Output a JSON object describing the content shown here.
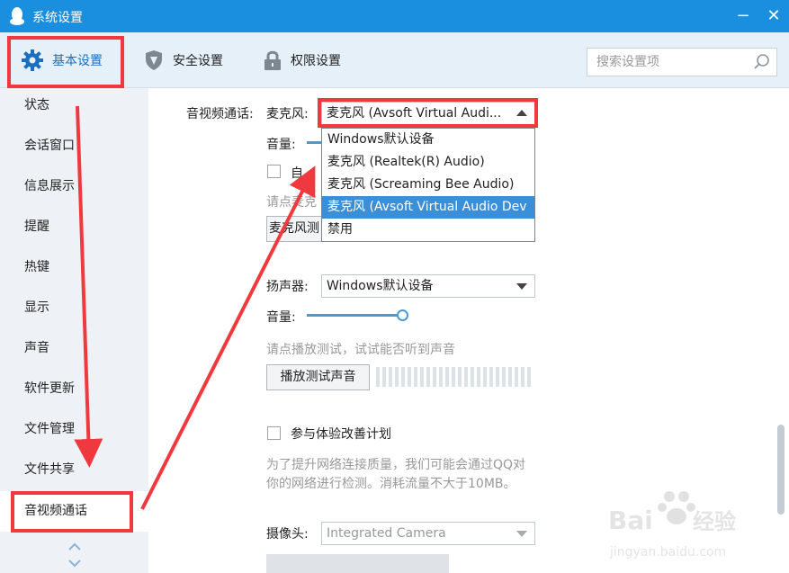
{
  "window": {
    "title": "系统设置",
    "minimize_glyph": "−",
    "close_glyph": "✕"
  },
  "tabs": [
    {
      "label": "基本设置",
      "icon": "gear-icon",
      "active": true
    },
    {
      "label": "安全设置",
      "icon": "shield-icon",
      "active": false
    },
    {
      "label": "权限设置",
      "icon": "lock-icon",
      "active": false
    }
  ],
  "search": {
    "placeholder": "搜索设置项"
  },
  "sidebar": {
    "items": [
      {
        "label": "状态"
      },
      {
        "label": "会话窗口"
      },
      {
        "label": "信息展示"
      },
      {
        "label": "提醒"
      },
      {
        "label": "热键"
      },
      {
        "label": "显示"
      },
      {
        "label": "声音"
      },
      {
        "label": "软件更新"
      },
      {
        "label": "文件管理"
      },
      {
        "label": "文件共享"
      },
      {
        "label": "音视频通话",
        "active": true
      }
    ]
  },
  "av": {
    "section_label": "音视频通话:",
    "mic_label": "麦克风:",
    "mic_selected": "麦克风 (Avsoft Virtual Audi...",
    "mic_volume_label": "音量:",
    "auto_adjust_label": "自",
    "mic_hint": "请点麦克",
    "mic_test_button": "麦克风测",
    "mic_options": [
      "Windows默认设备",
      "麦克风 (Realtek(R) Audio)",
      "麦克风 (Screaming Bee Audio)",
      "麦克风 (Avsoft Virtual Audio Dev",
      "禁用"
    ],
    "mic_highlighted_index": 3,
    "speaker_label": "扬声器:",
    "speaker_selected": "Windows默认设备",
    "speaker_volume_label": "音量:",
    "speaker_volume": 1.0,
    "speaker_hint": "请点播放测试，试试能否听到声音",
    "play_test_button": "播放测试声音",
    "ux_checkbox_label": "参与体验改善计划",
    "ux_checked": false,
    "ux_desc_line1": "为了提升网络连接质量，我们可能会通过QQ对",
    "ux_desc_line2": "你的网络进行检测。消耗流量不大于10MB。",
    "camera_label": "摄像头:",
    "camera_selected": "Integrated Camera"
  },
  "watermark": {
    "text": "Bai经验",
    "url": "jingyan.baidu.com"
  },
  "colors": {
    "titlebar": "#1a8fe0",
    "accent": "#1a6fc0",
    "annotation_red": "#f0393f",
    "selection_blue": "#3b8fd8"
  }
}
